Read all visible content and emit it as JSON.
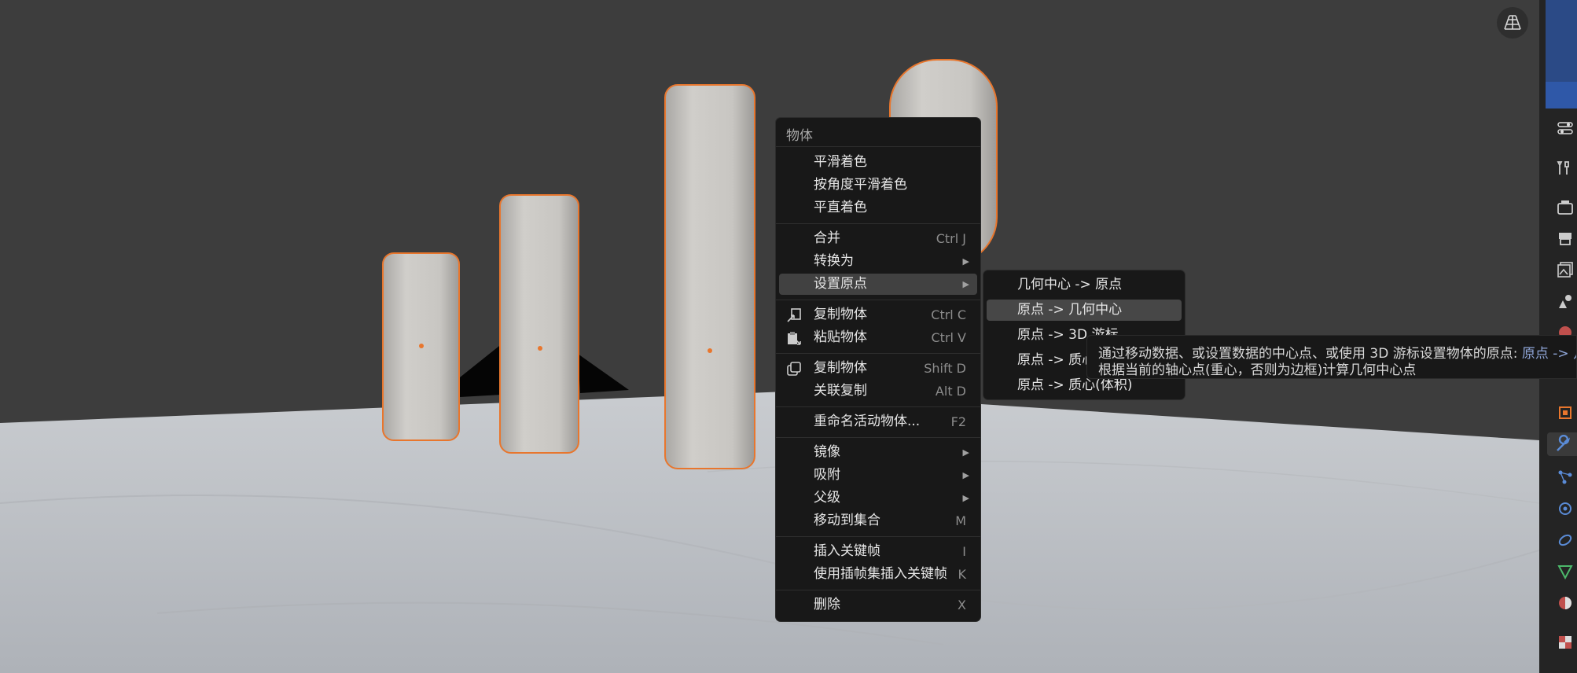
{
  "context_menu": {
    "title": "物体",
    "items": [
      {
        "label": "平滑着色",
        "shortcut": ""
      },
      {
        "label": "按角度平滑着色",
        "shortcut": ""
      },
      {
        "label": "平直着色",
        "shortcut": ""
      },
      {
        "label": "合并",
        "shortcut": "Ctrl J"
      },
      {
        "label": "转换为",
        "shortcut": ""
      },
      {
        "label": "设置原点",
        "shortcut": ""
      },
      {
        "label": "复制物体",
        "shortcut": "Ctrl C"
      },
      {
        "label": "粘贴物体",
        "shortcut": "Ctrl V"
      },
      {
        "label": "复制物体",
        "shortcut": "Shift D"
      },
      {
        "label": "关联复制",
        "shortcut": "Alt D"
      },
      {
        "label": "重命名活动物体...",
        "shortcut": "F2"
      },
      {
        "label": "镜像",
        "shortcut": ""
      },
      {
        "label": "吸附",
        "shortcut": ""
      },
      {
        "label": "父级",
        "shortcut": ""
      },
      {
        "label": "移动到集合",
        "shortcut": "M"
      },
      {
        "label": "插入关键帧",
        "shortcut": "I"
      },
      {
        "label": "使用插帧集插入关键帧",
        "shortcut": "K"
      },
      {
        "label": "删除",
        "shortcut": "X"
      }
    ]
  },
  "submenu": {
    "items": [
      {
        "label": "几何中心 -> 原点"
      },
      {
        "label": "原点 -> 几何中心"
      },
      {
        "label": "原点 -> 3D 游标"
      },
      {
        "label": "原点 -> 质心(表面)"
      },
      {
        "label": "原点 -> 质心(体积)"
      }
    ]
  },
  "tooltip": {
    "line1": "通过移动数据、或设置数据的中心点、或使用 3D 游标设置物体的原点:",
    "line1_accent": "原点 -> 几何中心",
    "line2": "根据当前的轴心点(重心，否则为边框)计算几何中心点"
  },
  "colors": {
    "selection_outline": "#e8762d",
    "menu_bg": "#181818",
    "highlight": "#414141",
    "accent_blue": "#2f58a8"
  },
  "icons": {
    "gizmo": "grid-perspective-icon",
    "strip": [
      "tool-settings-icon",
      "tool-icon",
      "render-icon",
      "output-icon",
      "view-layer-icon",
      "scene-icon",
      "world-icon",
      "object-icon",
      "modifier-icon",
      "particles-icon",
      "physics-icon",
      "constraints-icon",
      "data-icon",
      "material-icon",
      "texture-icon"
    ]
  }
}
